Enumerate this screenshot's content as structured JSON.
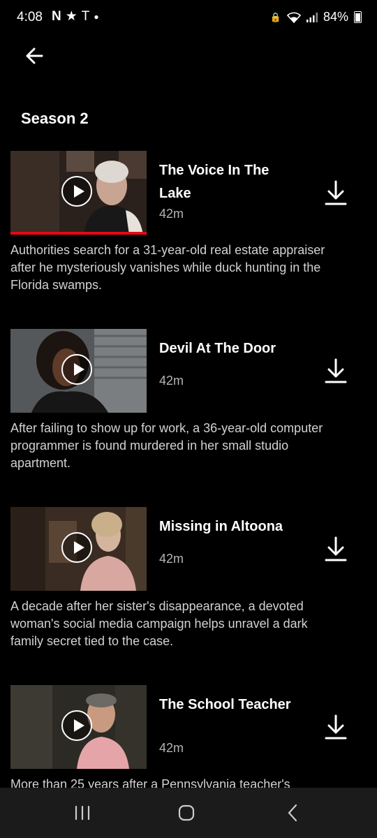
{
  "status_bar": {
    "time": "4:08",
    "battery": "84%"
  },
  "season": {
    "title": "Season 2"
  },
  "episodes": [
    {
      "title": "The Voice In The Lake",
      "duration": "42m",
      "description": "Authorities search for a 31-year-old real estate appraiser after he mysteriously vanishes while duck hunting in the Florida swamps.",
      "progress": 1.0
    },
    {
      "title": "Devil At The Door",
      "duration": "42m",
      "description": "After failing to show up for work, a 36-year-old computer programmer is found murdered in her small studio apartment."
    },
    {
      "title": "Missing in Altoona",
      "duration": "42m",
      "description": "A decade after her sister's disappearance, a devoted woman's social media campaign helps unravel a dark family secret tied to the case."
    },
    {
      "title": "The School Teacher",
      "duration": "42m",
      "description": "More than 25 years after a Pennsylvania teacher's"
    }
  ],
  "colors": {
    "accent": "#e50914",
    "background": "#000000",
    "nav_bar": "#1b1b1b"
  },
  "icons": [
    "back-arrow-icon",
    "play-icon",
    "download-icon",
    "recent-apps-icon",
    "home-icon",
    "nav-back-icon"
  ]
}
